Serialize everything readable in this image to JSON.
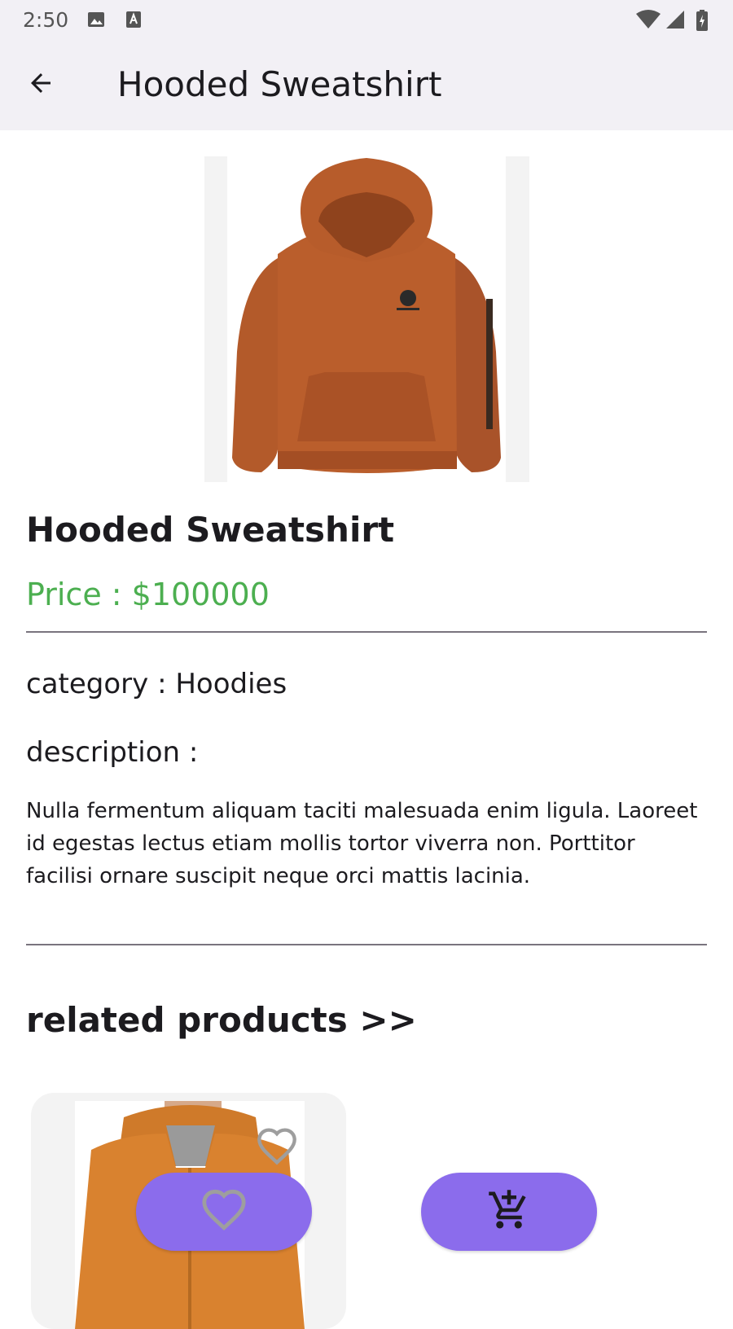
{
  "status_bar": {
    "time": "2:50",
    "icons": [
      "image-icon",
      "text-a-icon",
      "wifi-icon",
      "signal-icon",
      "battery-charging-icon"
    ]
  },
  "app_bar": {
    "title": "Hooded Sweatshirt",
    "back_icon": "arrow-back-icon"
  },
  "product": {
    "name": "Hooded Sweatshirt",
    "price": "Price : $100000",
    "category": "category : Hoodies",
    "description_label": "description :",
    "description": "Nulla fermentum aliquam taciti malesuada enim ligula. Laoreet id egestas lectus etiam mollis tortor viverra non. Porttitor facilisi ornare suscipit neque orci mattis lacinia."
  },
  "related": {
    "title": "related products >>"
  },
  "actions": {
    "favorite_icon": "heart-icon",
    "add_to_cart_icon": "add-shopping-cart-icon"
  },
  "colors": {
    "accent": "#8b6cec",
    "price": "#4caf50",
    "app_bar_bg": "#f2f0f5",
    "hoodie": "#b85d2c",
    "related_hoodie": "#d9822f"
  }
}
